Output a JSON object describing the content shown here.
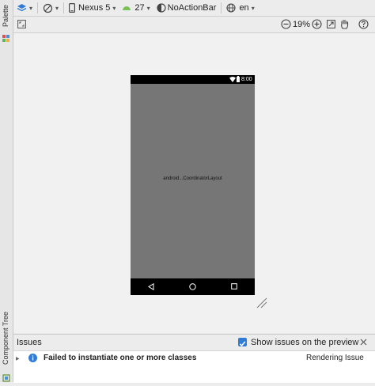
{
  "left_strip": {
    "palette_label": "Palette",
    "component_tree_label": "Component Tree"
  },
  "toolbar": {
    "device": "Nexus 5",
    "api_level": "27",
    "theme": "NoActionBar",
    "locale": "en",
    "zoom": "19%"
  },
  "preview": {
    "status_time": "8:00",
    "layout_label": "android...CoordinatorLayout"
  },
  "issues": {
    "title": "Issues",
    "show_on_preview_label": "Show issues on the preview",
    "show_on_preview_checked": true,
    "items": [
      {
        "message": "Failed to instantiate one or more classes",
        "category": "Rendering Issue"
      }
    ]
  },
  "colors": {
    "accent_blue": "#2f7bd6",
    "device_screen": "#767676",
    "system_bars": "#000000"
  }
}
